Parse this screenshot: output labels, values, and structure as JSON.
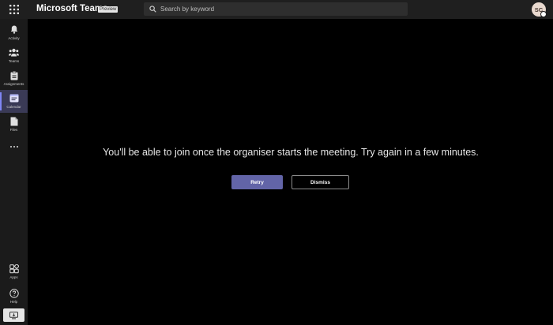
{
  "header": {
    "title": "Microsoft Teams",
    "badge": "Preview",
    "search_placeholder": "Search by keyword",
    "avatar_initials": "SC"
  },
  "sidebar": {
    "items": [
      {
        "label": "Activity",
        "icon": "bell-icon"
      },
      {
        "label": "Teams",
        "icon": "teams-icon"
      },
      {
        "label": "Assignments",
        "icon": "assignments-icon"
      },
      {
        "label": "Calendar",
        "icon": "calendar-icon",
        "active": true
      },
      {
        "label": "Files",
        "icon": "files-icon"
      }
    ],
    "bottom_items": [
      {
        "label": "Apps",
        "icon": "apps-icon"
      },
      {
        "label": "Help",
        "icon": "help-icon"
      }
    ]
  },
  "main": {
    "message": "You'll be able to join once the organiser starts the meeting. Try again in a few minutes.",
    "retry_label": "Retry",
    "dismiss_label": "Dismiss"
  },
  "colors": {
    "accent": "#6264a7",
    "active_bar": "#7f85f5"
  }
}
